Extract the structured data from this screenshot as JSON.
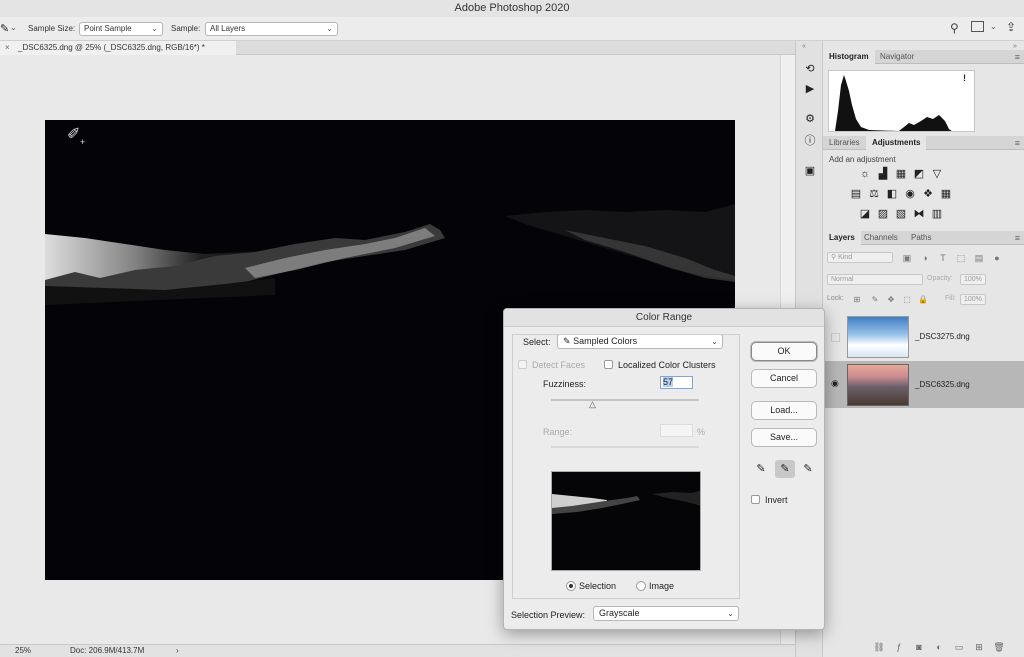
{
  "window": {
    "title": "Adobe Photoshop 2020"
  },
  "options_bar": {
    "sample_size_label": "Sample Size:",
    "sample_size_value": "Point Sample",
    "sample_label": "Sample:",
    "sample_value": "All Layers"
  },
  "document": {
    "tab_title": "_DSC6325.dng @ 25% (_DSC6325.dng, RGB/16*) *",
    "close_glyph": "×"
  },
  "status_bar": {
    "zoom": "25%",
    "doc_info": "Doc: 206.9M/413.7M",
    "arrow": "›"
  },
  "panels": {
    "top_tabs": [
      "Histogram",
      "Navigator"
    ],
    "mid_tabs": [
      "Libraries",
      "Adjustments"
    ],
    "add_adjustment": "Add an adjustment",
    "layer_tabs": [
      "Layers",
      "Channels",
      "Paths"
    ],
    "kind_filter": "Kind",
    "blend_mode": "Normal",
    "opacity_label": "Opacity:",
    "opacity_value": "100%",
    "lock_label": "Lock:",
    "fill_label": "Fill:",
    "fill_value": "100%",
    "warning_icon": "!"
  },
  "layers": [
    {
      "name": "_DSC3275.dng",
      "visible": false
    },
    {
      "name": "_DSC6325.dng",
      "visible": true
    }
  ],
  "dialog": {
    "title": "Color Range",
    "select_label": "Select:",
    "select_value": "Sampled Colors",
    "detect_faces": "Detect Faces",
    "localized_clusters": "Localized Color Clusters",
    "fuzziness_label": "Fuzziness:",
    "fuzziness_value": "57",
    "range_label": "Range:",
    "range_unit": "%",
    "ok": "OK",
    "cancel": "Cancel",
    "load": "Load...",
    "save": "Save...",
    "invert": "Invert",
    "radio_selection": "Selection",
    "radio_image": "Image",
    "preview_label": "Selection Preview:",
    "preview_value": "Grayscale"
  },
  "colors": {
    "canvas": "#040408",
    "dialog_bg": "#ececec",
    "selected_layer": "#b7b7b7"
  }
}
